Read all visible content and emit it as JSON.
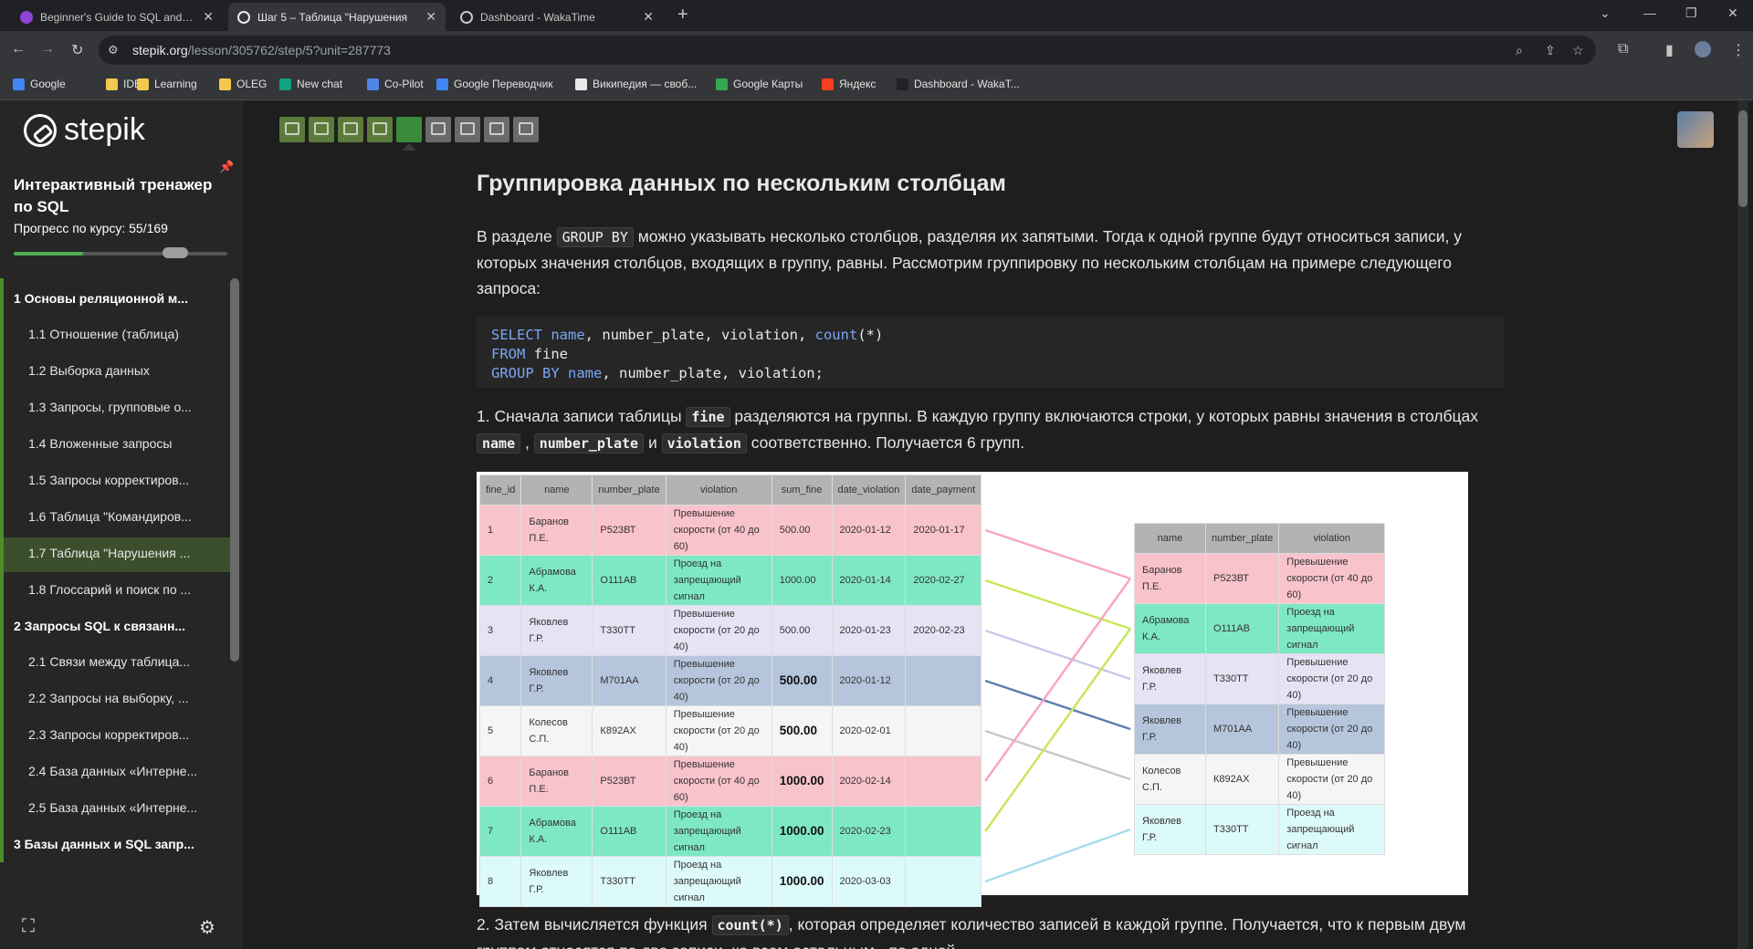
{
  "browser": {
    "tabs": [
      {
        "title": "Beginner's Guide to SQL and Po",
        "color": "#8e44d6"
      },
      {
        "title": "Шаг 5 – Таблица \"Нарушения",
        "color": "#e8eaed"
      },
      {
        "title": "Dashboard - WakaTime",
        "color": "#202124"
      }
    ],
    "url_host": "stepik.org",
    "url_path": "/lesson/305762/step/5?unit=287773",
    "bookmarks": [
      {
        "label": "Google",
        "color": "#4285f4"
      },
      {
        "label": "IDE",
        "color": "#f2c94c"
      },
      {
        "label": "Learning",
        "color": "#f2c94c"
      },
      {
        "label": "OLEG",
        "color": "#f2c94c"
      },
      {
        "label": "New chat",
        "color": "#10a37f"
      },
      {
        "label": "Co-Pilot",
        "color": "#4f86e8"
      },
      {
        "label": "Google Переводчик",
        "color": "#4285f4"
      },
      {
        "label": "Википедия — своб...",
        "color": "#e8e8e8"
      },
      {
        "label": "Google Карты",
        "color": "#34a853"
      },
      {
        "label": "Яндекс",
        "color": "#fc3f1d"
      },
      {
        "label": "Dashboard - WakaT...",
        "color": "#202124"
      }
    ]
  },
  "sidebar": {
    "logo": "stepik",
    "course_title": "Интерактивный тренажер по SQL",
    "progress_label": "Прогресс по курсу:  55/169",
    "progress_fraction": 0.325,
    "toc": [
      {
        "kind": "module",
        "label": "1  Основы реляционной м..."
      },
      {
        "kind": "lesson",
        "label": "1.1  Отношение (таблица)"
      },
      {
        "kind": "lesson",
        "label": "1.2  Выборка данных"
      },
      {
        "kind": "lesson",
        "label": "1.3  Запросы, групповые о..."
      },
      {
        "kind": "lesson",
        "label": "1.4  Вложенные запросы"
      },
      {
        "kind": "lesson",
        "label": "1.5  Запросы корректиров..."
      },
      {
        "kind": "lesson",
        "label": "1.6  Таблица \"Командиров..."
      },
      {
        "kind": "lesson",
        "label": "1.7  Таблица \"Нарушения ...",
        "active": true
      },
      {
        "kind": "lesson",
        "label": "1.8  Глоссарий и поиск по ..."
      },
      {
        "kind": "module",
        "label": "2  Запросы SQL к связанн..."
      },
      {
        "kind": "lesson",
        "label": "2.1  Связи между таблица..."
      },
      {
        "kind": "lesson",
        "label": "2.2  Запросы на выборку, ..."
      },
      {
        "kind": "lesson",
        "label": "2.3  Запросы корректиров..."
      },
      {
        "kind": "lesson",
        "label": "2.4  База данных «Интерне..."
      },
      {
        "kind": "lesson",
        "label": "2.5  База данных «Интерне..."
      },
      {
        "kind": "module",
        "label": "3  Базы данных и SQL запр..."
      }
    ]
  },
  "steps": [
    "done",
    "done",
    "done",
    "done",
    "cur",
    "todo",
    "todo",
    "todo",
    "todo"
  ],
  "lesson": {
    "title": "Группировка данных по нескольким столбцам",
    "p1_a": "В разделе ",
    "p1_code": "GROUP BY",
    "p1_b": " можно указывать несколько столбцов, разделяя их запятыми. Тогда к одной группе будут относиться записи, у которых значения столбцов, входящих в группу, равны. Рассмотрим группировку по нескольким столбцам на примере следующего запроса:",
    "code_lines": [
      [
        {
          "t": "SELECT",
          "k": true
        },
        {
          "t": " name",
          "k": true
        },
        {
          "t": ", number_plate, violation, "
        },
        {
          "t": "count",
          "k": true
        },
        {
          "t": "(*)"
        }
      ],
      [
        {
          "t": "FROM",
          "k": true
        },
        {
          "t": " fine"
        }
      ],
      [
        {
          "t": "GROUP BY",
          "k": true
        },
        {
          "t": " name",
          "k": true
        },
        {
          "t": ", number_plate, violation;"
        }
      ]
    ],
    "p2_a": "1. Сначала записи таблицы ",
    "p2_code1": "fine",
    "p2_b": " разделяются на группы. В каждую группу включаются строки, у которых равны значения в столбцах ",
    "p2_code2": "name",
    "p2_c": " , ",
    "p2_code3": "number_plate",
    "p2_d": " и ",
    "p2_code4": "violation",
    "p2_e": " соответственно. Получается 6 групп.",
    "p3_a": "2. Затем вычисляется функция ",
    "p3_code": "count(*)",
    "p3_b": ", которая определяет количество записей в каждой группе. Получается, что к первым двум группам относятся по две записи, ко всем остальным - по одной."
  },
  "figure": {
    "left_headers": [
      "fine_id",
      "name",
      "number_plate",
      "violation",
      "sum_fine",
      "date_violation",
      "date_payment"
    ],
    "left_rows": [
      {
        "c": [
          "1",
          "Баранов П.Е.",
          "Р523ВТ",
          "Превышение скорости (от 40 до 60)",
          "500.00",
          "2020-01-12",
          "2020-01-17"
        ],
        "bg": "#f9c3cb",
        "big": false
      },
      {
        "c": [
          "2",
          "Абрамова К.А.",
          "О111АВ",
          "Проезд на запрещающий сигнал",
          "1000.00",
          "2020-01-14",
          "2020-02-27"
        ],
        "bg": "#7ee8c4",
        "big": false
      },
      {
        "c": [
          "3",
          "Яковлев Г.Р.",
          "Т330ТТ",
          "Превышение скорости (от 20 до 40)",
          "500.00",
          "2020-01-23",
          "2020-02-23"
        ],
        "bg": "#e4e4f5",
        "big": false
      },
      {
        "c": [
          "4",
          "Яковлев Г.Р.",
          "М701АА",
          "Превышение скорости (от 20 до 40)",
          "500.00",
          "2020-01-12",
          ""
        ],
        "bg": "#b5c5db",
        "big": true
      },
      {
        "c": [
          "5",
          "Колесов С.П.",
          "К892АХ",
          "Превышение скорости (от 20 до 40)",
          "500.00",
          "2020-02-01",
          ""
        ],
        "bg": "#f5f5f5",
        "big": true
      },
      {
        "c": [
          "6",
          "Баранов П.Е.",
          "Р523ВТ",
          "Превышение скорости (от 40 до 60)",
          "1000.00",
          "2020-02-14",
          ""
        ],
        "bg": "#f9c3cb",
        "big": true
      },
      {
        "c": [
          "7",
          "Абрамова К.А.",
          "О111АВ",
          "Проезд на запрещающий сигнал",
          "1000.00",
          "2020-02-23",
          ""
        ],
        "bg": "#7ee8c4",
        "big": true
      },
      {
        "c": [
          "8",
          "Яковлев Г.Р.",
          "Т330ТТ",
          "Проезд на запрещающий сигнал",
          "1000.00",
          "2020-03-03",
          ""
        ],
        "bg": "#ddfafa",
        "big": true
      }
    ],
    "right_headers": [
      "name",
      "number_plate",
      "violation"
    ],
    "right_rows": [
      {
        "c": [
          "Баранов П.Е.",
          "Р523ВТ",
          "Превышение скорости (от 40 до 60)"
        ],
        "bg": "#f9c3cb"
      },
      {
        "c": [
          "Абрамова К.А.",
          "О111АВ",
          "Проезд на запрещающий сигнал"
        ],
        "bg": "#7ee8c4"
      },
      {
        "c": [
          "Яковлев Г.Р.",
          "Т330ТТ",
          "Превышение скорости (от 20 до 40)"
        ],
        "bg": "#e4e4f5"
      },
      {
        "c": [
          "Яковлев Г.Р.",
          "М701АА",
          "Превышение скорости (от 20 до 40)"
        ],
        "bg": "#b5c5db"
      },
      {
        "c": [
          "Колесов С.П.",
          "К892АХ",
          "Превышение скорости (от 20 до 40)"
        ],
        "bg": "#f5f5f5"
      },
      {
        "c": [
          "Яковлев Г.Р.",
          "Т330ТТ",
          "Проезд на запрещающий сигнал"
        ],
        "bg": "#ddfafa"
      }
    ],
    "links": [
      {
        "from": 0,
        "to": 0,
        "color": "#f7a6c4"
      },
      {
        "from": 1,
        "to": 1,
        "color": "#c8e85a"
      },
      {
        "from": 2,
        "to": 2,
        "color": "#c8c8ea"
      },
      {
        "from": 3,
        "to": 3,
        "color": "#5a7fb0"
      },
      {
        "from": 4,
        "to": 4,
        "color": "#c8c8c8"
      },
      {
        "from": 5,
        "to": 0,
        "color": "#f7a6c4"
      },
      {
        "from": 6,
        "to": 1,
        "color": "#c8e85a"
      },
      {
        "from": 7,
        "to": 5,
        "color": "#a8dcec"
      }
    ]
  }
}
